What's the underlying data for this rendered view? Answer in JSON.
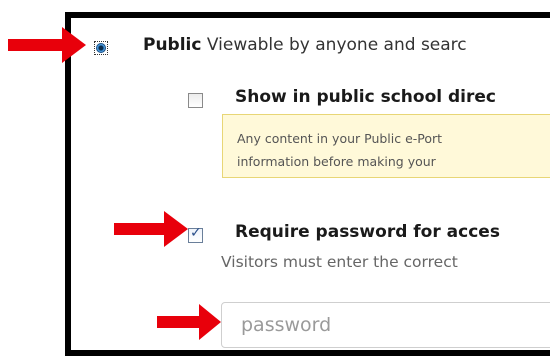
{
  "visibility": {
    "public_option": {
      "label": "Public",
      "description": "Viewable by anyone and searc",
      "selected": true
    },
    "directory_checkbox": {
      "label": "Show in public school direc",
      "checked": false
    },
    "notice": {
      "line1": "Any content in your Public e-Port",
      "line2": "information before making your"
    },
    "password_checkbox": {
      "label": "Require password for acces",
      "checked": true
    },
    "helper_text": "Visitors must enter the correct",
    "password_field": {
      "placeholder": "password",
      "value": ""
    }
  },
  "colors": {
    "arrow": "#e8000b",
    "notice_bg": "#fff9d9",
    "notice_border": "#e8d676"
  },
  "icons": {
    "radio": "radio-selected-icon",
    "checkbox_checked": "checkmark-icon",
    "arrow": "red-arrow-icon"
  }
}
